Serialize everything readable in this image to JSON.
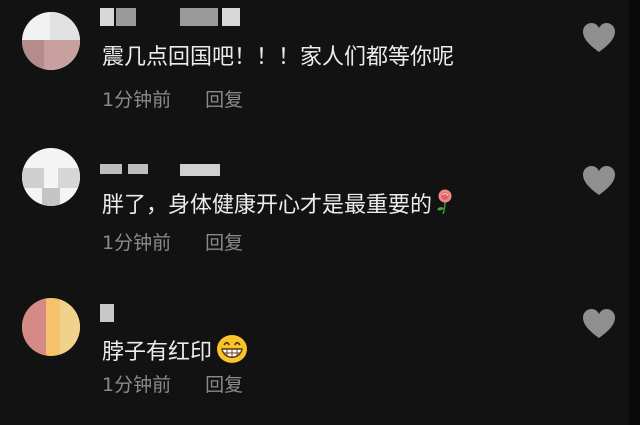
{
  "comments": [
    {
      "text": "震几点回国吧！！！家人们都等你呢",
      "time": "1分钟前",
      "reply_label": "回复",
      "emoji": null
    },
    {
      "text": "胖了，身体健康开心才是最重要的",
      "time": "1分钟前",
      "reply_label": "回复",
      "emoji": "rose-emoji"
    },
    {
      "text": "脖子有红印",
      "time": "1分钟前",
      "reply_label": "回复",
      "emoji": "grinning-face-emoji"
    }
  ],
  "colors": {
    "background": "#121212",
    "text": "#ececec",
    "meta": "#8a8a8a",
    "heart": "#8f8f8f"
  }
}
